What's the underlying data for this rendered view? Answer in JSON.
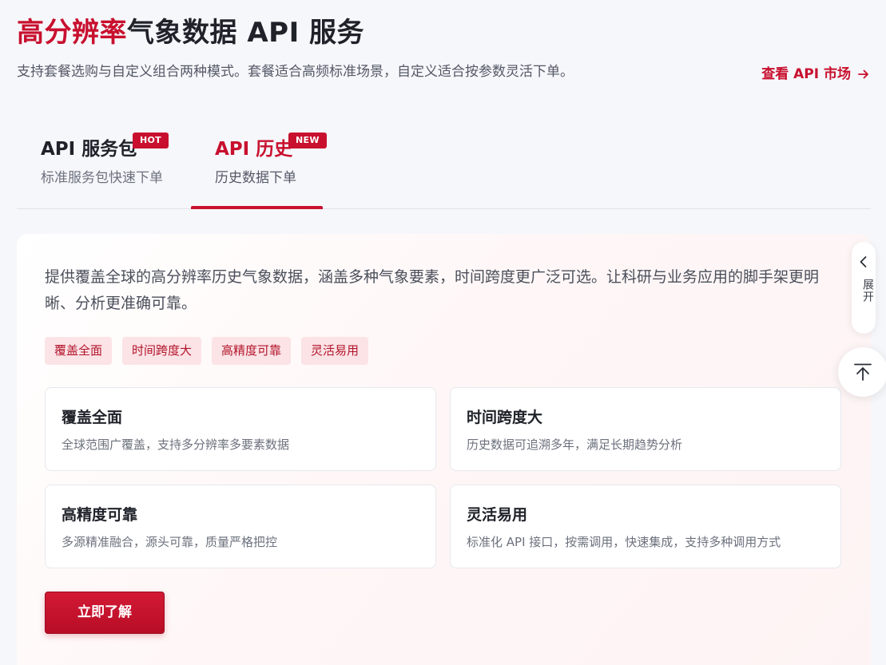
{
  "header": {
    "title_accent": "高分辨率",
    "title_rest": "气象数据 API 服务",
    "subtitle": "支持套餐选购与自定义组合两种模式。套餐适合高频标准场景，自定义适合按参数灵活下单。",
    "market_link": "查看 API 市场",
    "market_link_icon": "arrow-right-icon"
  },
  "tabs": [
    {
      "label": "API 服务包",
      "badge": "HOT",
      "description": "标准服务包快速下单",
      "active": false
    },
    {
      "label": "API 历史",
      "badge": "NEW",
      "description": "历史数据下单",
      "active": true
    }
  ],
  "panel": {
    "intro": "提供覆盖全球的高分辨率历史气象数据，涵盖多种气象要素，时间跨度更广泛可选。让科研与业务应用的脚手架更明晰、分析更准确可靠。",
    "tags": [
      "覆盖全面",
      "时间跨度大",
      "高精度可靠",
      "灵活易用"
    ],
    "cards": [
      {
        "title": "覆盖全面",
        "description": "全球范围广覆盖，支持多分辨率多要素数据"
      },
      {
        "title": "时间跨度大",
        "description": "历史数据可追溯多年，满足长期趋势分析"
      },
      {
        "title": "高精度可靠",
        "description": "多源精准融合，源头可靠，质量严格把控"
      },
      {
        "title": "灵活易用",
        "description": "标准化 API 接口，按需调用，快速集成，支持多种调用方式"
      }
    ],
    "cta_label": "立即了解"
  },
  "side": {
    "expand_label": "展开",
    "expand_icon": "chevron-left-icon",
    "scroll_top_icon": "back-to-top-icon"
  },
  "colors": {
    "accent": "#c8102e",
    "tag_background": "#fbe3e6",
    "page_background": "#f6f7fb"
  }
}
